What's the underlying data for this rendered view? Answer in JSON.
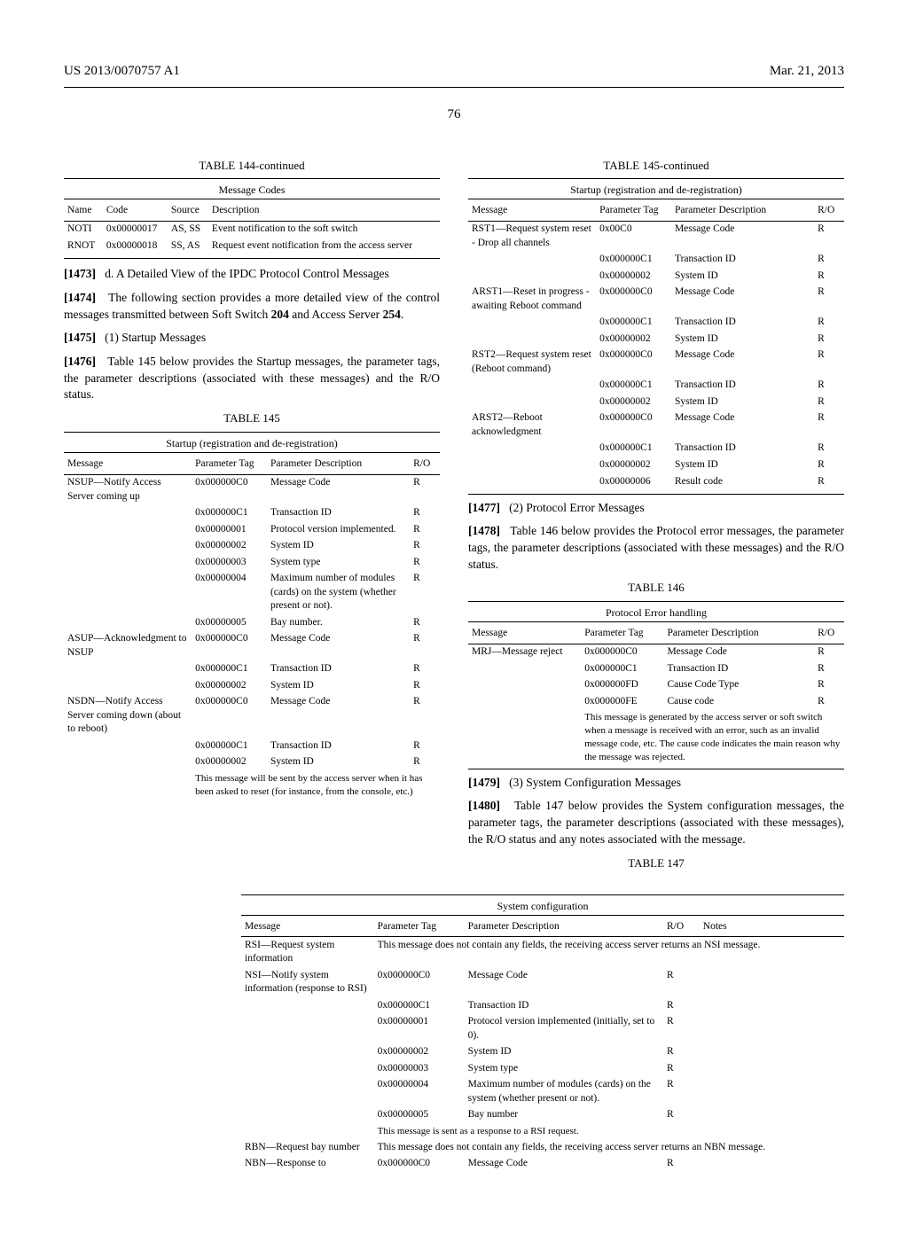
{
  "header": {
    "left": "US 2013/0070757 A1",
    "right": "Mar. 21, 2013"
  },
  "pageNum": "76",
  "table144": {
    "title": "TABLE 144-continued",
    "subtitle": "Message Codes",
    "headers": [
      "Name",
      "Code",
      "Source",
      "Description"
    ],
    "rows": [
      [
        "NOTI",
        "0x00000017",
        "AS, SS",
        "Event notification to the soft switch"
      ],
      [
        "RNOT",
        "0x00000018",
        "SS, AS",
        "Request event notification from the access server"
      ]
    ]
  },
  "para1473": {
    "num": "[1473]",
    "text": "d. A Detailed View of the IPDC Protocol Control Messages"
  },
  "para1474": {
    "num": "[1474]",
    "text": "The following section provides a more detailed view of the control messages transmitted between Soft Switch ",
    "ref1": "204",
    "mid": " and Access Server ",
    "ref2": "254",
    "end": "."
  },
  "para1475": {
    "num": "[1475]",
    "text": "(1) Startup Messages"
  },
  "para1476": {
    "num": "[1476]",
    "text": "Table 145 below provides the Startup messages, the parameter tags, the parameter descriptions (associated with these messages) and the R/O status."
  },
  "table145": {
    "title": "TABLE 145",
    "subtitle": "Startup (registration and de-registration)",
    "headers": [
      "Message",
      "Parameter Tag",
      "Parameter Description",
      "R/O"
    ],
    "rows": [
      [
        "NSUP—Notify Access Server coming up",
        "0x000000C0",
        "Message Code",
        "R"
      ],
      [
        "",
        "0x000000C1",
        "Transaction ID",
        "R"
      ],
      [
        "",
        "0x00000001",
        "Protocol version implemented.",
        "R"
      ],
      [
        "",
        "0x00000002",
        "System ID",
        "R"
      ],
      [
        "",
        "0x00000003",
        "System type",
        "R"
      ],
      [
        "",
        "0x00000004",
        "Maximum number of modules (cards) on the system (whether present or not).",
        "R"
      ],
      [
        "",
        "0x00000005",
        "Bay number.",
        "R"
      ],
      [
        "ASUP—Acknowledgment to NSUP",
        "0x000000C0",
        "Message Code",
        "R"
      ],
      [
        "",
        "0x000000C1",
        "Transaction ID",
        "R"
      ],
      [
        "",
        "0x00000002",
        "System ID",
        "R"
      ],
      [
        "NSDN—Notify Access Server coming down (about to reboot)",
        "0x000000C0",
        "Message Code",
        "R"
      ],
      [
        "",
        "0x000000C1",
        "Transaction ID",
        "R"
      ],
      [
        "",
        "0x00000002",
        "System ID",
        "R"
      ]
    ],
    "note": "This message will be sent by the access server when it has been asked to reset (for instance, from the console, etc.)"
  },
  "table145cont": {
    "title": "TABLE 145-continued",
    "subtitle": "Startup (registration and de-registration)",
    "headers": [
      "Message",
      "Parameter Tag",
      "Parameter Description",
      "R/O"
    ],
    "rows": [
      [
        "RST1—Request system reset - Drop all channels",
        "0x00C0",
        "Message Code",
        "R"
      ],
      [
        "",
        "0x000000C1",
        "Transaction ID",
        "R"
      ],
      [
        "",
        "0x00000002",
        "System ID",
        "R"
      ],
      [
        "ARST1—Reset in progress - awaiting Reboot command",
        "0x000000C0",
        "Message Code",
        "R"
      ],
      [
        "",
        "0x000000C1",
        "Transaction ID",
        "R"
      ],
      [
        "",
        "0x00000002",
        "System ID",
        "R"
      ],
      [
        "RST2—Request system reset (Reboot command)",
        "0x000000C0",
        "Message Code",
        "R"
      ],
      [
        "",
        "0x000000C1",
        "Transaction ID",
        "R"
      ],
      [
        "",
        "0x00000002",
        "System ID",
        "R"
      ],
      [
        "ARST2—Reboot acknowledgment",
        "0x000000C0",
        "Message Code",
        "R"
      ],
      [
        "",
        "0x000000C1",
        "Transaction ID",
        "R"
      ],
      [
        "",
        "0x00000002",
        "System ID",
        "R"
      ],
      [
        "",
        "0x00000006",
        "Result code",
        "R"
      ]
    ]
  },
  "para1477": {
    "num": "[1477]",
    "text": "(2) Protocol Error Messages"
  },
  "para1478": {
    "num": "[1478]",
    "text": "Table 146 below provides the Protocol error messages, the parameter tags, the parameter descriptions (associated with these messages) and the R/O status."
  },
  "table146": {
    "title": "TABLE 146",
    "subtitle": "Protocol Error handling",
    "headers": [
      "Message",
      "Parameter Tag",
      "Parameter Description",
      "R/O"
    ],
    "rows": [
      [
        "MRJ—Message reject",
        "0x000000C0",
        "Message Code",
        "R"
      ],
      [
        "",
        "0x000000C1",
        "Transaction ID",
        "R"
      ],
      [
        "",
        "0x000000FD",
        "Cause Code Type",
        "R"
      ],
      [
        "",
        "0x000000FE",
        "Cause code",
        "R"
      ]
    ],
    "note": "This message is generated by the access server or soft switch when a message is received with an error, such as an invalid message code, etc. The cause code indicates the main reason why the message was rejected."
  },
  "para1479": {
    "num": "[1479]",
    "text": "(3) System Configuration Messages"
  },
  "para1480": {
    "num": "[1480]",
    "text": "Table 147 below provides the System configuration messages, the parameter tags, the parameter descriptions (associated with these messages), the R/O status and any notes associated with the message."
  },
  "table147": {
    "title": "TABLE 147",
    "subtitle": "System configuration",
    "headers": [
      "Message",
      "Parameter Tag",
      "Parameter Description",
      "R/O",
      "Notes"
    ],
    "rows": [
      [
        "RSI—Request system information",
        "",
        "This message does not contain any fields, the receiving access server returns an NSI message.",
        "",
        ""
      ],
      [
        "NSI—Notify system information (response to RSI)",
        "0x000000C0",
        "Message Code",
        "R",
        ""
      ],
      [
        "",
        "0x000000C1",
        "Transaction ID",
        "R",
        ""
      ],
      [
        "",
        "0x00000001",
        "Protocol version implemented (initially, set to 0).",
        "R",
        ""
      ],
      [
        "",
        "0x00000002",
        "System ID",
        "R",
        ""
      ],
      [
        "",
        "0x00000003",
        "System type",
        "R",
        ""
      ],
      [
        "",
        "0x00000004",
        "Maximum number of modules (cards) on the system (whether present or not).",
        "R",
        ""
      ],
      [
        "",
        "0x00000005",
        "Bay number",
        "R",
        ""
      ],
      [
        "",
        "",
        "This message is sent as a response to a RSI request.",
        "",
        ""
      ],
      [
        "RBN—Request bay number",
        "",
        "This message does not contain any fields, the receiving access server returns an NBN message.",
        "",
        ""
      ],
      [
        "NBN—Response to",
        "0x000000C0",
        "Message Code",
        "R",
        ""
      ]
    ]
  }
}
